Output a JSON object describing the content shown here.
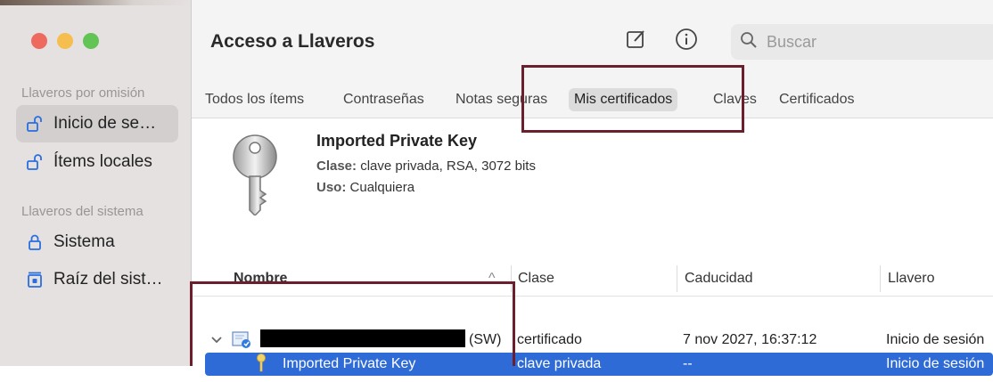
{
  "window": {
    "title": "Acceso a Llaveros",
    "search_placeholder": "Buscar"
  },
  "sidebar": {
    "section_default": "Llaveros por omisión",
    "section_system": "Llaveros del sistema",
    "items": [
      {
        "label": "Inicio de se…",
        "icon": "unlocked-padlock-icon",
        "selected": true
      },
      {
        "label": "Ítems locales",
        "icon": "unlocked-padlock-icon",
        "selected": false
      },
      {
        "label": "Sistema",
        "icon": "locked-padlock-icon",
        "selected": false
      },
      {
        "label": "Raíz del sist…",
        "icon": "cabinet-icon",
        "selected": false
      }
    ]
  },
  "tabs": [
    {
      "label": "Todos los ítems",
      "active": false
    },
    {
      "label": "Contraseñas",
      "active": false
    },
    {
      "label": "Notas seguras",
      "active": false
    },
    {
      "label": "Mis certificados",
      "active": true
    },
    {
      "label": "Claves",
      "active": false
    },
    {
      "label": "Certificados",
      "active": false
    }
  ],
  "detail": {
    "title": "Imported Private Key",
    "clase_label": "Clase:",
    "clase_value": "clave privada, RSA, 3072 bits",
    "uso_label": "Uso:",
    "uso_value": "Cualquiera"
  },
  "table": {
    "columns": [
      "Nombre",
      "Clase",
      "Caducidad",
      "Llavero"
    ],
    "rows": [
      {
        "name": "(SW)",
        "clase": "certificado",
        "caducidad": "7 nov 2027, 16:37:12",
        "llavero": "Inicio de sesión",
        "selected": false
      },
      {
        "name": "Imported Private Key",
        "clase": "clave privada",
        "caducidad": "--",
        "llavero": "Inicio de sesión",
        "selected": true
      }
    ]
  },
  "colors": {
    "accent": "#2f6bd6",
    "highlight_box": "#6b1f2d"
  }
}
